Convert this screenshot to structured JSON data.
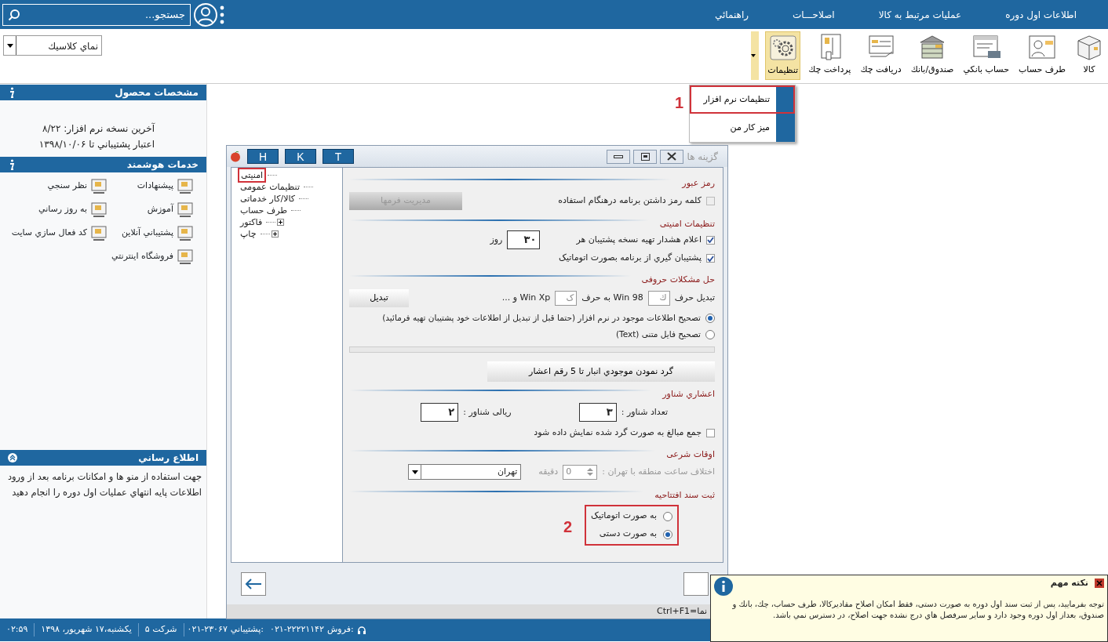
{
  "menubar": {
    "items": [
      "اطلاعات اول دوره",
      "عمليات مرتبط به كالا",
      "اصلاحـــات",
      "راهنمائي"
    ],
    "search": {
      "placeholder": "جستجو..."
    }
  },
  "toolbar": {
    "buttons": [
      {
        "label": "کالا",
        "selected": false
      },
      {
        "label": "طرف حساب",
        "selected": false
      },
      {
        "label": "حساب بانكي",
        "selected": false
      },
      {
        "label": "صندوق/بانك",
        "selected": false
      },
      {
        "label": "دریافت چك",
        "selected": false
      },
      {
        "label": "پرداخت چك",
        "selected": false
      },
      {
        "label": "تنظیمات",
        "selected": true
      }
    ],
    "view_select": {
      "value": "نماي كلاسيك"
    }
  },
  "settings_menu": {
    "step": "1",
    "items": [
      {
        "label": "تنظیمات نرم افزار",
        "highlighted": true
      },
      {
        "label": "میز کار من",
        "highlighted": false
      }
    ]
  },
  "sidebar": {
    "product_title": "مشخصات محصول",
    "product_lines": [
      "آخرين نسخه نرم افزار: ۸/۲۲",
      "اعتبار پشتيباني تا ۱۳۹۸/۱۰/۰۶"
    ],
    "services_title": "خدمات هوشمند",
    "services": [
      "پیشنهادات",
      "نظر سنجي",
      "آموزش",
      "به روز رساني",
      "پشتيباني آنلاين",
      "كد فعال سازي سايت",
      "فروشگاه اينترنتي"
    ],
    "news_title": "اطلاع رساني",
    "news_text": "جهت استفاده از منو ها و امکانات برنامه بعد از ورود اطلاعات پایه انتهاي عمليات اول دوره را انجام دهيد"
  },
  "dialog": {
    "title": "گزینه ها",
    "letter_buttons": [
      "T",
      "K",
      "H"
    ],
    "tree": [
      {
        "label": "امنیتی",
        "kind": "leaf",
        "selected": true
      },
      {
        "label": "تنظیمات عمومی",
        "kind": "leaf",
        "selected": false
      },
      {
        "label": "کالا/کار خدماتی",
        "kind": "leaf",
        "selected": false
      },
      {
        "label": "طرف حساب",
        "kind": "leaf",
        "selected": false
      },
      {
        "label": "فاکتور",
        "kind": "group",
        "selected": false
      },
      {
        "label": "چاپ",
        "kind": "group",
        "selected": false
      }
    ],
    "sections": [
      {
        "title": "رمز عبور",
        "rows": [
          {
            "kind": "checkbox",
            "label": "کلمه رمز داشتن برنامه درهنگام استفاده",
            "checked": false,
            "disabled": true,
            "side_button": "مدیریت فرمها"
          }
        ]
      },
      {
        "title": "تنظیمات امنیتی",
        "rows": [
          {
            "kind": "checkbox",
            "label": "اعلام هشدار  تهیه نسخه پشتیبان  هر",
            "checked": true,
            "field": "۳۰",
            "unit": "روز"
          },
          {
            "kind": "checkbox",
            "label": "پشتیبان گیري از برنامه بصورت اتوماتیک",
            "checked": true
          }
        ]
      },
      {
        "title": "حل مشکلات حروفی",
        "rows": [
          {
            "kind": "conversion",
            "label": "تبدیل حرف",
            "from": "ك",
            "middle": "Win 98 به حرف",
            "to": "ک",
            "suffix": "Win Xp و ...",
            "button": "تبدیل"
          },
          {
            "kind": "radio",
            "label": "تصحیح اطلاعات موجود در نرم افزار (حتما قبل از تبدیل از اطلاعات خود پشتیبان تهیه فرمائید)",
            "selected": true
          },
          {
            "kind": "radio",
            "label": "تصحیح فایل متنی (Text)",
            "selected": false
          },
          {
            "kind": "progress",
            "level": 0
          },
          {
            "kind": "button",
            "label": "گرد نمودن موجودي انبار تا 5 رقم اعشار"
          }
        ]
      },
      {
        "title": "اعشاري شناور",
        "rows": [
          {
            "kind": "pair",
            "items": [
              {
                "label": "تعداد شناور :",
                "value": "۳"
              },
              {
                "label": "ریالی شناور :",
                "value": "۲"
              }
            ]
          },
          {
            "kind": "checkbox",
            "label": "جمع مبالغ به صورت گرد شده نمایش داده شود",
            "checked": false
          }
        ]
      },
      {
        "title": "اوقات شرعی",
        "rows": [
          {
            "kind": "time_offset",
            "label": "اختلاف ساعت منطقه با تهران :",
            "value": "0",
            "unit": "دقیقه",
            "city": "تهران",
            "disabled": true
          }
        ]
      },
      {
        "title": "ثبت سند افتتاحیه",
        "rows": [
          {
            "kind": "radio_group",
            "annotated": true,
            "step": "2",
            "options": [
              {
                "label": "به صورت اتوماتیک",
                "selected": false
              },
              {
                "label": "به صورت دستی",
                "selected": true
              }
            ]
          }
        ]
      }
    ],
    "help_hint": "Ctrl+F1=نما"
  },
  "notice": {
    "title": "نکته مهم",
    "text": "توجه بفرمایید، پس از ثبت سند اول دوره به صورت دستی، فقط امکان اصلاح مقادیرکالا، طرف حساب، چك، بانك و صندوق، بعداز اول دوره وجود دارد و سایر سرفصل هاي درج نشده جهت اصلاح، در دسترس نمي باشد."
  },
  "status_bar": {
    "time": "۰۲:۵۹",
    "date": "يكشنبه،۱۷ شهريور، ۱۳۹۸",
    "company": "شرکت ۵",
    "phones": [
      {
        "label": "فروش:",
        "value": "۰۲۱-۲۲۲۲۱۱۴۲"
      },
      {
        "label": "پشتيباني:",
        "value": "۰۲۱-۲۳۰۶۷"
      }
    ]
  }
}
